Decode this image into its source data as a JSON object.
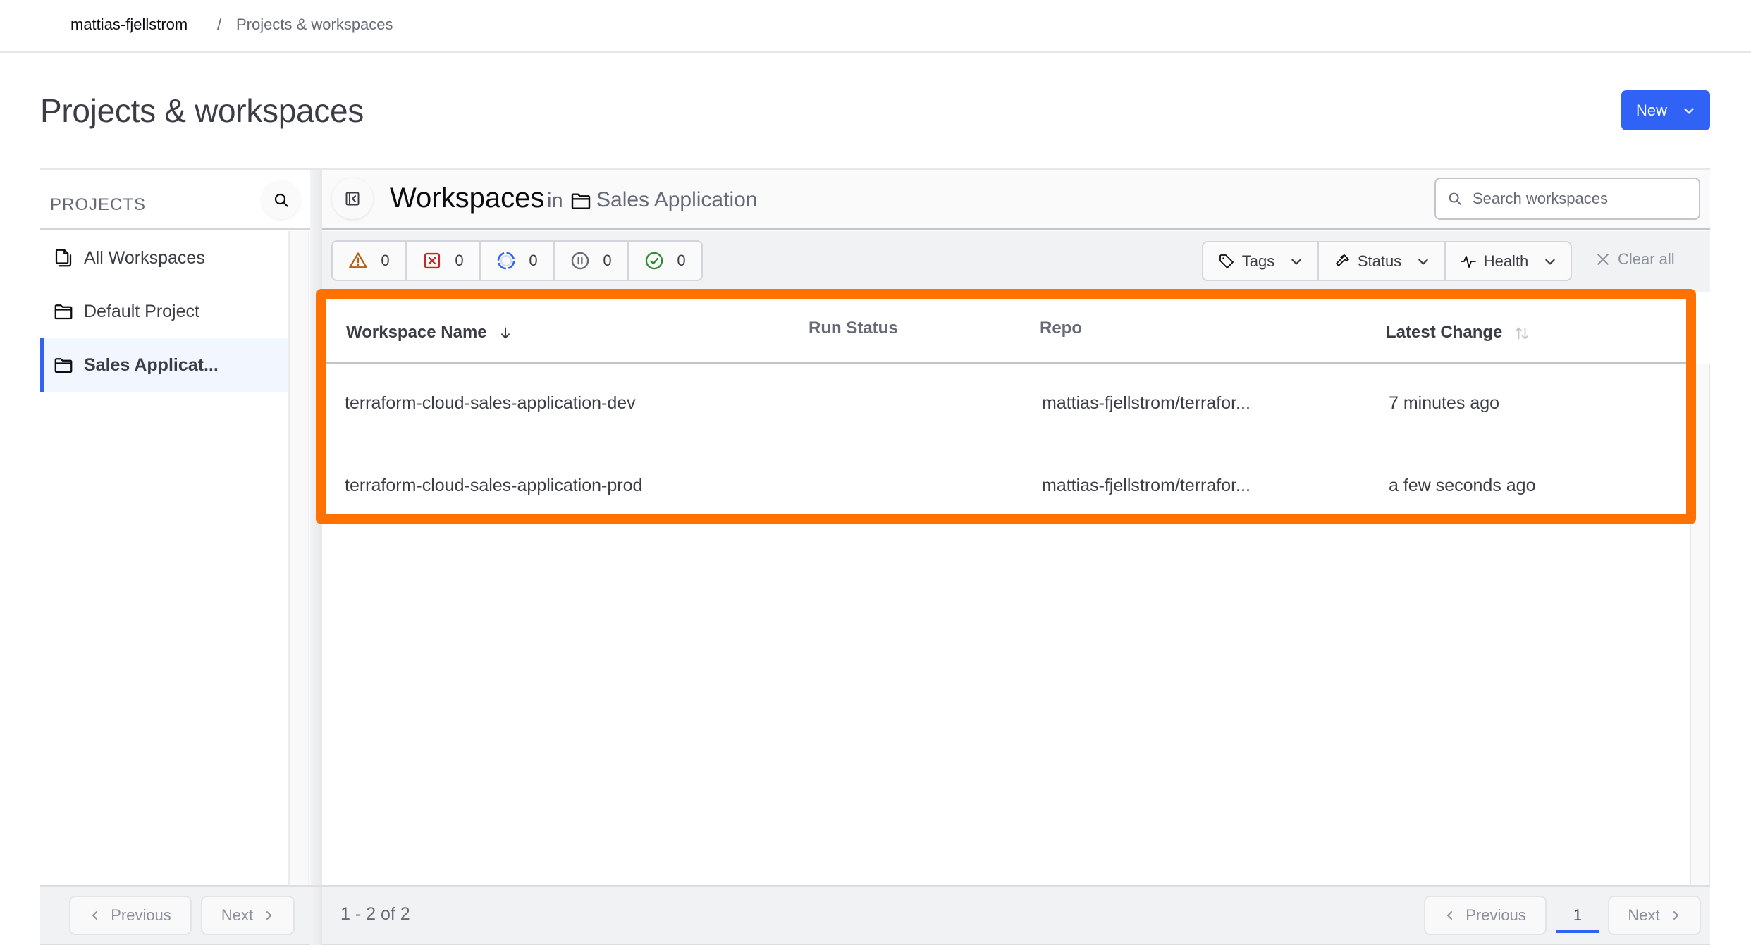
{
  "breadcrumb": {
    "org": "mattias-fjellstrom",
    "separator": "/",
    "current": "Projects & workspaces"
  },
  "page": {
    "title": "Projects & workspaces",
    "new_button": "New"
  },
  "sidebar": {
    "heading": "PROJECTS",
    "items": [
      {
        "label": "All Workspaces",
        "icon": "files-icon",
        "active": false
      },
      {
        "label": "Default Project",
        "icon": "folder-icon",
        "active": false
      },
      {
        "label": "Sales Applicat...",
        "icon": "folder-icon",
        "active": true
      }
    ],
    "pagination": {
      "previous": "Previous",
      "next": "Next"
    }
  },
  "main": {
    "title": "Workspaces",
    "in_label": "in",
    "project": "Sales Application",
    "search_placeholder": "Search workspaces",
    "status_counts": [
      {
        "name": "warning",
        "count": "0",
        "color": "#b4621a"
      },
      {
        "name": "errored",
        "count": "0",
        "color": "#c0282a"
      },
      {
        "name": "running",
        "count": "0",
        "color": "#2f62f5"
      },
      {
        "name": "paused",
        "count": "0",
        "color": "#656a76"
      },
      {
        "name": "success",
        "count": "0",
        "color": "#2e8b30"
      }
    ],
    "filters": {
      "tags": "Tags",
      "status": "Status",
      "health": "Health",
      "clear_all": "Clear all"
    },
    "table": {
      "columns": [
        "Workspace Name",
        "Run Status",
        "Repo",
        "Latest Change"
      ],
      "rows": [
        {
          "name": "terraform-cloud-sales-application-dev",
          "run_status": "",
          "repo": "mattias-fjellstrom/terrafor...",
          "latest_change": "7 minutes ago"
        },
        {
          "name": "terraform-cloud-sales-application-prod",
          "run_status": "",
          "repo": "mattias-fjellstrom/terrafor...",
          "latest_change": "a few seconds ago"
        }
      ]
    },
    "pagination": {
      "summary": "1 - 2 of 2",
      "previous": "Previous",
      "current_page": "1",
      "next": "Next"
    }
  },
  "colors": {
    "accent": "#2f62f5",
    "highlight": "#ff7100"
  }
}
